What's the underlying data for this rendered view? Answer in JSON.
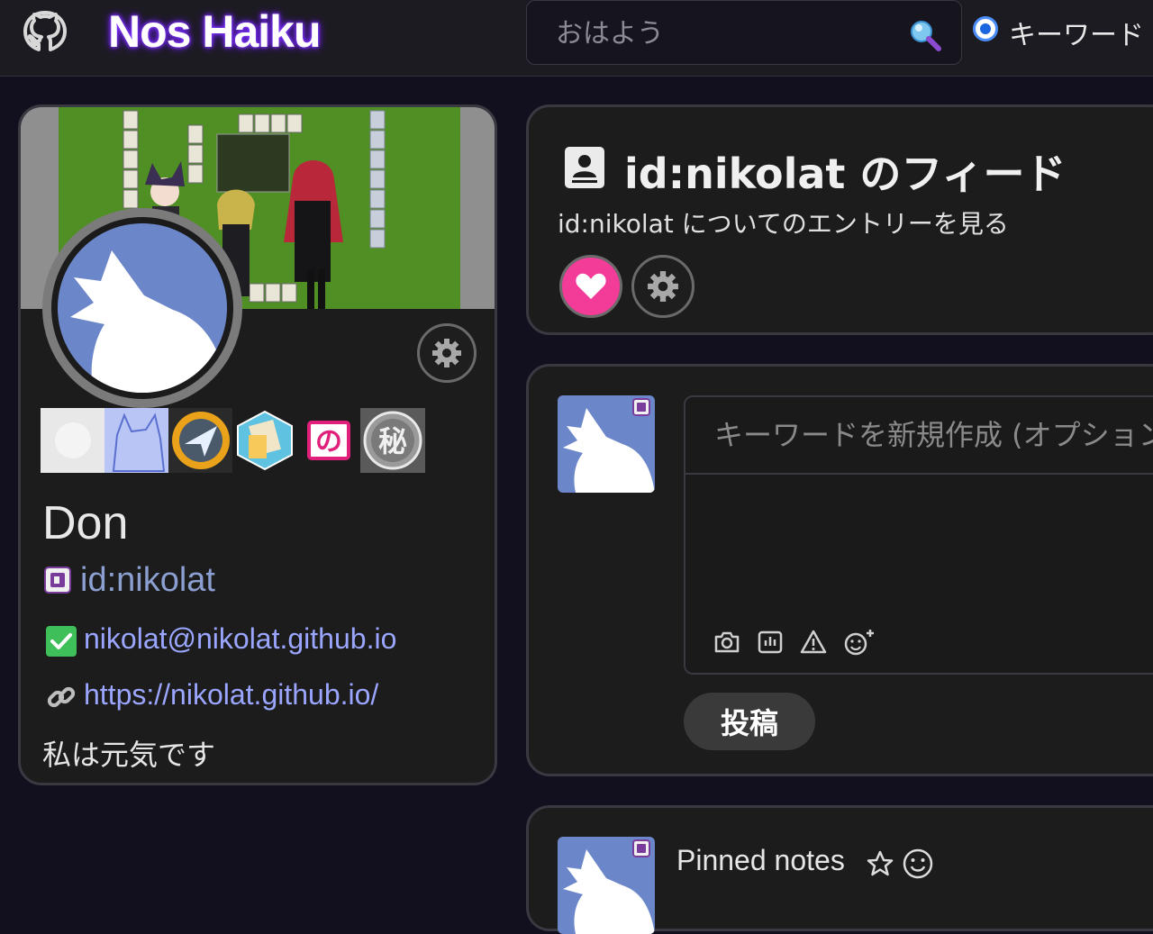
{
  "header": {
    "brand": "Nos Haiku",
    "search": {
      "placeholder": "おはよう",
      "value": ""
    },
    "search_mode_label": "キーワード"
  },
  "profile": {
    "display_name": "Don",
    "handle": "id:nikolat",
    "email": "nikolat@nikolat.github.io",
    "website": "https://nikolat.github.io/",
    "bio": "私は元気です",
    "badges": [
      "plain-badge",
      "cat-badge",
      "compass-badge",
      "tiles-badge",
      "no-badge",
      "secret-badge"
    ]
  },
  "feed": {
    "title": "id:nikolat のフィード",
    "subtitle": "id:nikolat についてのエントリーを見る"
  },
  "composer": {
    "keyword_placeholder": "キーワードを新規作成 (オプション)",
    "body_value": "",
    "post_label": "投稿"
  },
  "pinned": {
    "label": "Pinned notes"
  },
  "colors": {
    "background": "#120f1e",
    "panel": "#1c1c1c",
    "accent_link": "#9aa6ff",
    "heart": "#f23c97",
    "avatar": "#6b86c9",
    "banner": "#4f8f24"
  },
  "icons": [
    "github-icon",
    "search-icon",
    "gear-icon",
    "heart-icon",
    "contact-card-icon",
    "verified-check-icon",
    "link-icon",
    "camera-icon",
    "poll-icon",
    "warning-icon",
    "emoji-add-icon",
    "star-icon",
    "emoji-icon",
    "id-badge-icon"
  ]
}
